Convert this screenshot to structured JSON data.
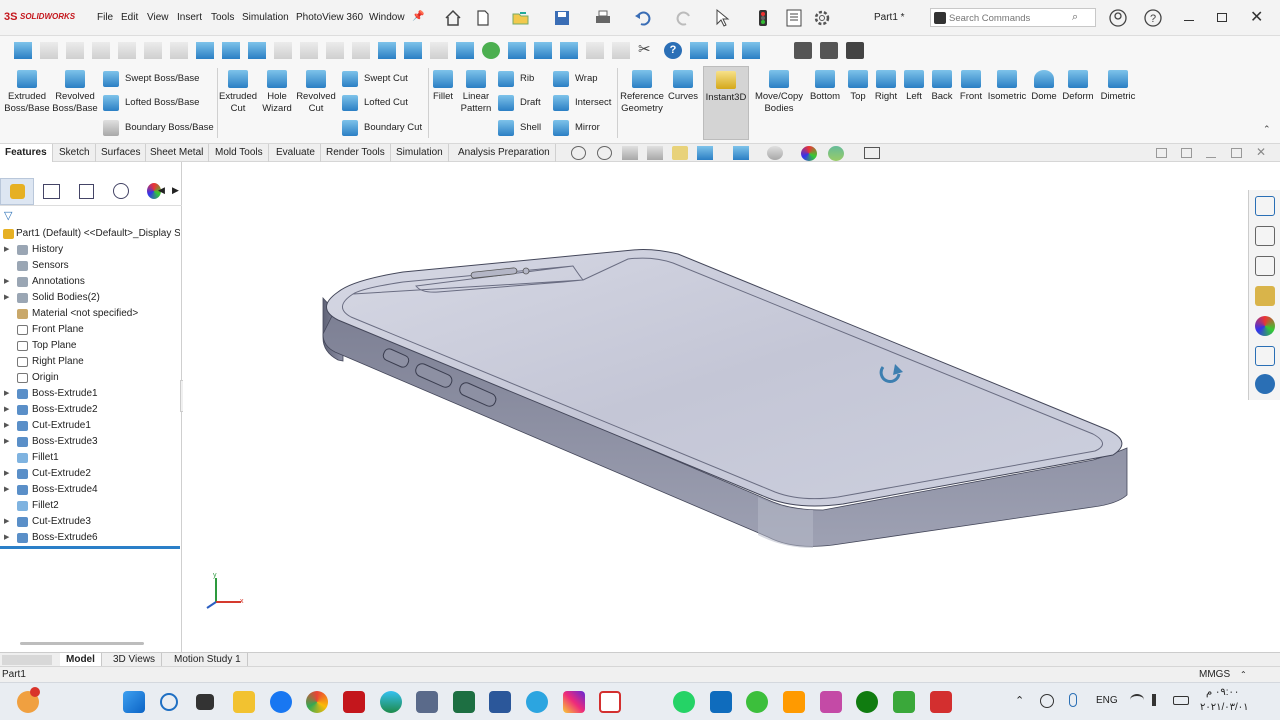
{
  "app": {
    "brand": "SOLIDWORKS",
    "document_title": "Part1 *",
    "search_placeholder": "Search Commands"
  },
  "menu": [
    "File",
    "Edit",
    "View",
    "Insert",
    "Tools",
    "Simulation",
    "PhotoView 360",
    "Window"
  ],
  "ribbon": {
    "extruded_boss": "Extruded Boss/Base",
    "revolved_boss": "Revolved Boss/Base",
    "swept_boss": "Swept Boss/Base",
    "lofted_boss": "Lofted Boss/Base",
    "boundary_boss": "Boundary Boss/Base",
    "extruded_cut": "Extruded Cut",
    "hole_wizard": "Hole Wizard",
    "revolved_cut": "Revolved Cut",
    "swept_cut": "Swept Cut",
    "lofted_cut": "Lofted Cut",
    "boundary_cut": "Boundary Cut",
    "fillet": "Fillet",
    "linear_pattern": "Linear Pattern",
    "rib": "Rib",
    "draft": "Draft",
    "shell": "Shell",
    "wrap": "Wrap",
    "intersect": "Intersect",
    "mirror": "Mirror",
    "reference_geometry": "Reference Geometry",
    "curves": "Curves",
    "instant3d": "Instant3D",
    "move_copy": "Move/Copy Bodies",
    "bottom": "Bottom",
    "top": "Top",
    "right": "Right",
    "left": "Left",
    "back": "Back",
    "front": "Front",
    "isometric": "Isometric",
    "dome": "Dome",
    "deform": "Deform",
    "dimetric": "Dimetric"
  },
  "tabs": [
    "Features",
    "Sketch",
    "Surfaces",
    "Sheet Metal",
    "Mold Tools",
    "Evaluate",
    "Render Tools",
    "Simulation",
    "Analysis Preparation"
  ],
  "tree": {
    "root": "Part1 (Default) <<Default>_Display S",
    "items": [
      "History",
      "Sensors",
      "Annotations",
      "Solid Bodies(2)",
      "Material <not specified>",
      "Front Plane",
      "Top Plane",
      "Right Plane",
      "Origin",
      "Boss-Extrude1",
      "Boss-Extrude2",
      "Cut-Extrude1",
      "Boss-Extrude3",
      "Fillet1",
      "Cut-Extrude2",
      "Boss-Extrude4",
      "Fillet2",
      "Cut-Extrude3",
      "Boss-Extrude6"
    ]
  },
  "bottom_tabs": [
    "Model",
    "3D Views",
    "Motion Study 1"
  ],
  "status": {
    "left": "Part1",
    "units": "MMGS"
  },
  "triad": {
    "x": "x",
    "y": "y"
  },
  "taskbar": {
    "language": "ENG",
    "time": "٠٩:٠٠ م",
    "date": "٢٠٢١/٠٣/٠١"
  }
}
